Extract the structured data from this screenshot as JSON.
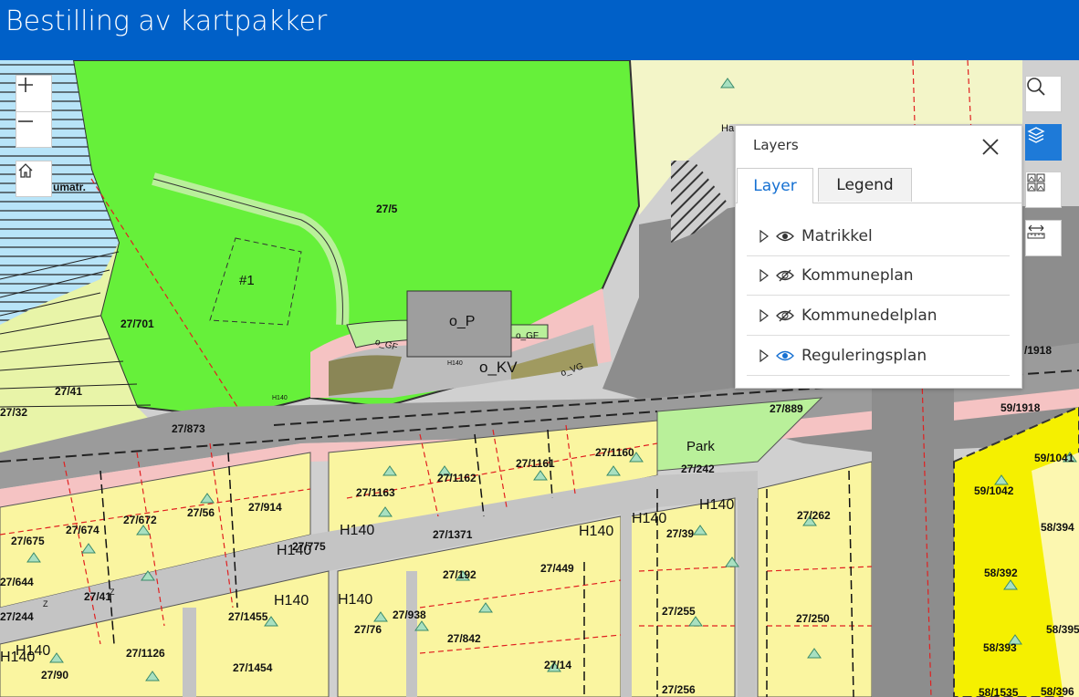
{
  "header": {
    "title": "Bestilling av kartpakker"
  },
  "map_labels": {
    "l_27_5": "27/5",
    "l_27_701": "27/701",
    "l_27_41": "27/41",
    "l_27_32": "27/32",
    "l_27_873": "27/873",
    "l_27_889": "27/889",
    "l_59_1918a": "59/1918",
    "l_59_1918b": "/1918",
    "l_27_1160": "27/1160",
    "l_27_1161": "27/1161",
    "l_27_1162": "27/1162",
    "l_27_1163": "27/1163",
    "l_27_242": "27/242",
    "l_27_914": "27/914",
    "l_27_56": "27/56",
    "l_27_672": "27/672",
    "l_27_674": "27/674",
    "l_27_675": "27/675",
    "l_27_644": "27/644",
    "l_27_41b": "27/41",
    "l_27_244": "27/244",
    "l_27_775": "27/775",
    "l_27_1371": "27/1371",
    "l_27_192": "27/192",
    "l_27_449": "27/449",
    "l_27_39": "27/39",
    "l_27_262": "27/262",
    "l_27_1455": "27/1455",
    "l_27_76": "27/76",
    "l_27_938": "27/938",
    "l_27_842": "27/842",
    "l_27_255": "27/255",
    "l_27_250": "27/250",
    "l_27_1126": "27/1126",
    "l_27_1454": "27/1454",
    "l_27_90": "27/90",
    "l_27_14": "27/14",
    "l_27_256": "27/256",
    "l_59_1042": "59/1042",
    "l_59_1041": "59/1041",
    "l_58_394": "58/394",
    "l_58_392": "58/392",
    "l_58_395": "58/395",
    "l_58_393": "58/393",
    "l_58_396": "58/396",
    "l_58_1535": "58/1535",
    "umatr": "umatr.",
    "hash1": "#1",
    "oP": "o_P",
    "oKV": "o_KV",
    "oGF1": "o_GF",
    "oGF2": "o_GF",
    "oVG": "o_VG",
    "park": "Park",
    "h140a": "H140",
    "h140b": "H140",
    "h140c": "H140",
    "h140d": "H140",
    "h140e": "H140",
    "h140f": "H140",
    "h140g": "H140",
    "h140h": "H140",
    "h140i": "H140",
    "h140s1": "H140",
    "h140s2": "H140",
    "z1": "Z",
    "z2": "Z",
    "hamisc": "Ha"
  },
  "controls": {
    "zoom_in": "+",
    "zoom_out": "—"
  },
  "layers_panel": {
    "title": "Layers",
    "tabs": [
      "Layer",
      "Legend"
    ],
    "selected_tab": "Layer",
    "layers": [
      {
        "label": "Matrikkel",
        "visible": true
      },
      {
        "label": "Kommuneplan",
        "visible": false
      },
      {
        "label": "Kommunedelplan",
        "visible": false
      },
      {
        "label": "Reguleringsplan",
        "visible": true
      }
    ]
  },
  "colors": {
    "header": "#0060c8",
    "green": "#66f03a",
    "yellow": "#faf5a0",
    "bright_yellow": "#f5f000",
    "lightgreen": "#b9f09a",
    "road": "#aaaaaa",
    "pink": "#f5c3c3",
    "water": "#b8e4f8",
    "accent": "#1570d2"
  }
}
